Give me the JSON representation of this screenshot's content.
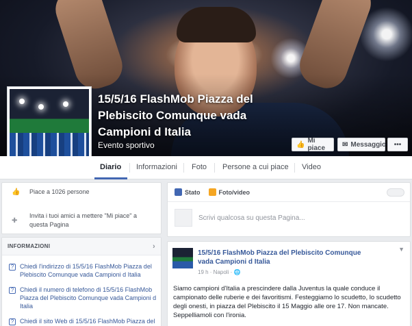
{
  "cover": {
    "title": "15/5/16 FlashMob Piazza del Plebiscito Comunque vada Campioni d Italia",
    "category": "Evento sportivo",
    "buttons": {
      "like": "Mi piace",
      "message": "Messaggio",
      "more": "•••"
    }
  },
  "tabs": [
    "Diario",
    "Informazioni",
    "Foto",
    "Persone a cui piace",
    "Video"
  ],
  "about": {
    "likes": "Piace a 1026 persone",
    "invite": "Invita i tuoi amici a mettere \"Mi piace\" a questa Pagina"
  },
  "info": {
    "header": "INFORMAZIONI",
    "items": [
      "Chiedi l'indirizzo di 15/5/16 FlashMob Piazza del Plebiscito Comunque vada Campioni d Italia",
      "Chiedi il numero di telefono di 15/5/16 FlashMob Piazza del Plebiscito Comunque vada Campioni d Italia",
      "Chiedi il sito Web di 15/5/16 FlashMob Piazza del"
    ]
  },
  "composer": {
    "tab_status": "Stato",
    "tab_photo": "Foto/video",
    "placeholder": "Scrivi qualcosa su questa Pagina..."
  },
  "post": {
    "title": "15/5/16 FlashMob Piazza del Plebiscito Comunque vada Campioni d Italia",
    "meta": "19 h · Napoli · 🌐",
    "body": "Siamo campioni d'Italia a prescindere dalla Juventus la quale conduce il campionato delle ruberie e dei favoritismi. Festeggiamo lo scudetto, lo scudetto degli onesti, in piazza del Plebiscito il 15 Maggio alle ore 17. Non mancate. Seppelliamoli con l'ironia."
  },
  "colors": {
    "accent": "#4267b2",
    "link": "#365899",
    "background": "#e9ebee"
  }
}
